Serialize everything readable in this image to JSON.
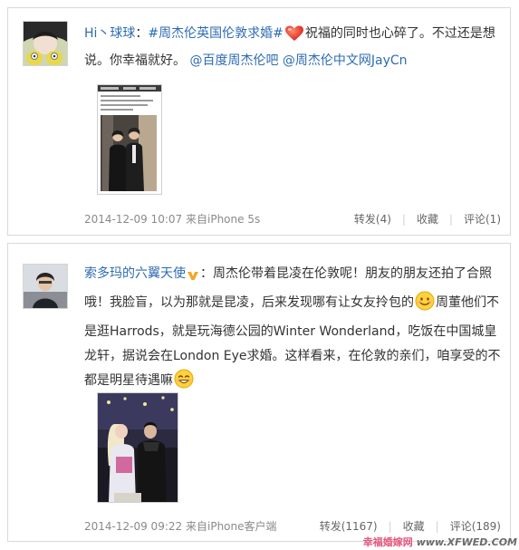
{
  "posts": [
    {
      "author": "Hi丶球球",
      "colon": "：",
      "topic": "#周杰伦英国伦敦求婚#",
      "emoji1": "heart-emoji",
      "text1": "祝福的同时也心碎了。不过还是想说。你幸福就好。",
      "mention1": "@百度周杰伦吧",
      "mention2": "@周杰伦中文网JayCn",
      "time": "2014-12-09 10:07",
      "source": "来自iPhone 5s",
      "repost": "转发(4)",
      "favorite": "收藏",
      "comment": "评论(1)"
    },
    {
      "author": "索多玛的六翼天使",
      "badge": "v-badge-icon",
      "colon": "：",
      "text1": "周杰伦带着昆凌在伦敦呢！朋友的朋友还拍了合照哦！我脸盲，以为那就是昆凌，后来发现哪有让女友拎包的",
      "emoji1": "smile-emoji",
      "text2": "周董他们不是逛Harrods，就是玩海德公园的Winter Wonderland，吃饭在中国城皇龙轩，据说会在London Eye求婚。这样看来，在伦敦的亲们，咱享受的不都是明星待遇嘛",
      "emoji2": "grin-emoji",
      "time": "2014-12-09 09:22",
      "source": "来自iPhone客户端",
      "repost": "转发(1167)",
      "favorite": "收藏",
      "comment": "评论(189)"
    }
  ],
  "separator": "|",
  "watermark": {
    "site_cn": "幸福婚嫁网",
    "site_url": "www.XFWED.COM"
  },
  "colors": {
    "link": "#2d6bb3",
    "border": "#d9d9d9",
    "meta": "#8a8a8a"
  }
}
